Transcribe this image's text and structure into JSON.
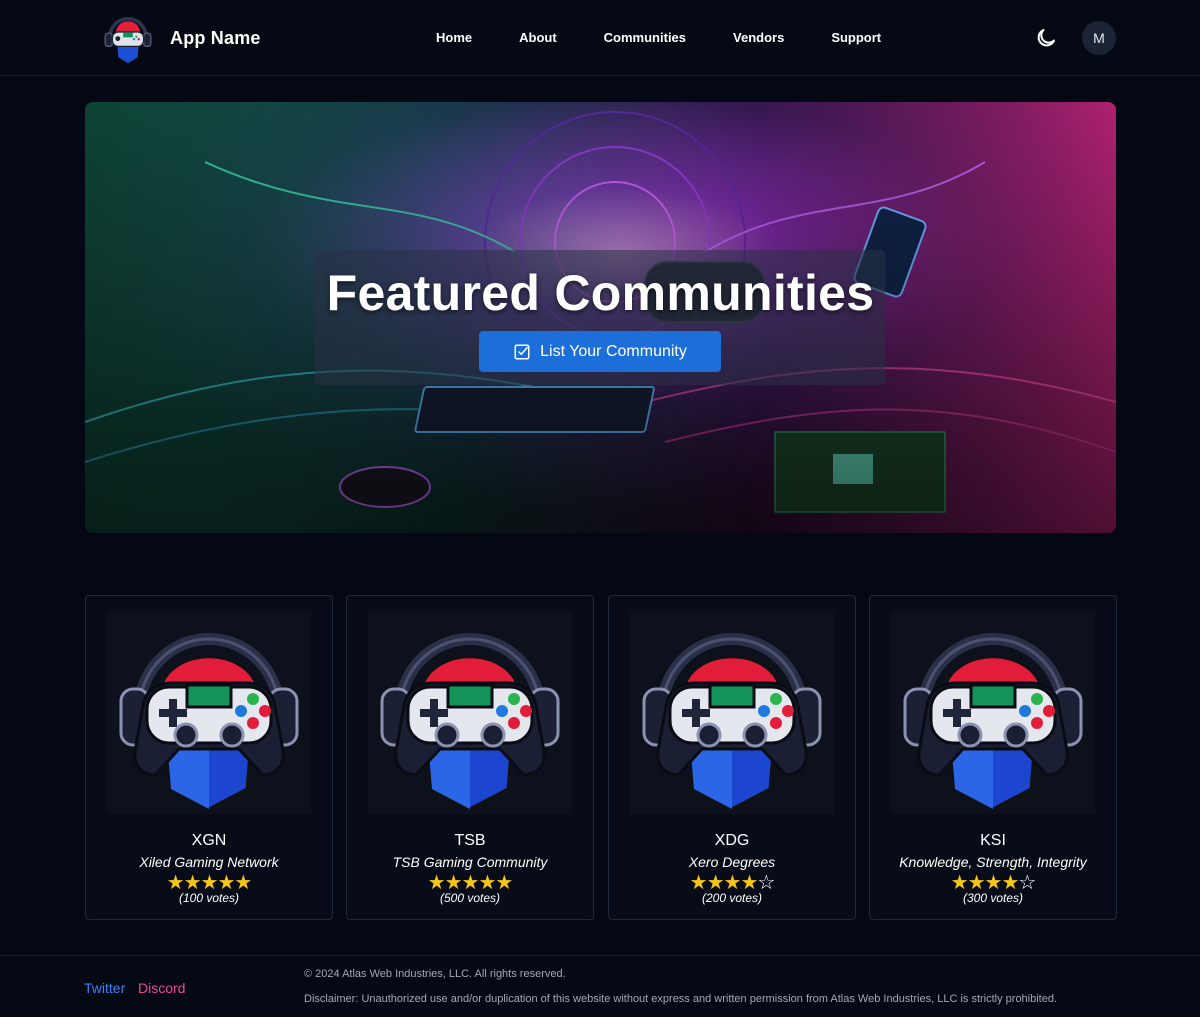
{
  "header": {
    "app_name": "App Name",
    "nav": [
      "Home",
      "About",
      "Communities",
      "Vendors",
      "Support"
    ],
    "avatar_initial": "M",
    "theme_icon": "moon-icon"
  },
  "hero": {
    "title": "Featured Communities",
    "button_label": "List Your Community",
    "button_icon": "checkbox-icon"
  },
  "communities": [
    {
      "abbr": "XGN",
      "name": "Xiled Gaming Network",
      "rating": 5,
      "votes": "(100 votes)"
    },
    {
      "abbr": "TSB",
      "name": "TSB Gaming Community",
      "rating": 5,
      "votes": "(500 votes)"
    },
    {
      "abbr": "XDG",
      "name": "Xero Degrees",
      "rating": 4,
      "votes": "(200 votes)"
    },
    {
      "abbr": "KSI",
      "name": "Knowledge, Strength, Integrity",
      "rating": 4,
      "votes": "(300 votes)"
    }
  ],
  "footer": {
    "social": [
      "Twitter",
      "Discord"
    ],
    "copyright": "© 2024 Atlas Web Industries, LLC. All rights reserved.",
    "disclaimer": "Disclaimer: Unauthorized use and/or duplication of this website without express and written permission from Atlas Web Industries, LLC is strictly prohibited."
  },
  "colors": {
    "background": "#040812",
    "accent_button": "#1c6fd9",
    "star": "#f5c518",
    "twitter": "#3b82f6",
    "discord": "#ec4899"
  }
}
